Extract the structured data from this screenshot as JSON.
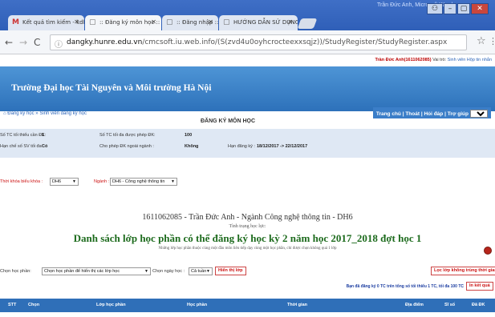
{
  "browser": {
    "tabs": [
      {
        "favicon": "M",
        "title": "Kết quả tìm kiếm - kdhc",
        "active": false
      },
      {
        "favicon": "▢",
        "title": ":: Đăng ký môn học ::",
        "active": true
      },
      {
        "favicon": "▢",
        "title": ":: Đăng nhập ::",
        "active": false
      },
      {
        "favicon": "▢",
        "title": "HƯỚNG DẪN SỬ DỤNG",
        "active": false
      }
    ],
    "url_prefix": "ⓘ ",
    "url_domain": "dangky.hunre.edu.vn",
    "url_path": "/cmcsoft.iu.web.info/(S(zvd4u0oyhcrocteexxsqjz))/StudyRegister/StudyRegister.aspx",
    "user_ghost": "Trần Đức Anh, Microsoft Word"
  },
  "page": {
    "user_name": "Trần Đức Anh(1611062085)",
    "user_role": "Vai trò:",
    "user_role_value": "Sinh viên Hộp tin nhắn",
    "header_title": "Trường Đại học Tài Nguyên và Môi trường Hà Nội",
    "breadcrumb": "⌂ Đăng ký học » Sinh viên đăng ký học",
    "page_title": "ĐĂNG KÝ MÔN HỌC",
    "top_links": "Trang chủ | Thoát | Hỏi đáp | Trợ giúp",
    "lang": "VN",
    "info": {
      "min_credits_label": "Số TC tối thiểu cần ĐK:",
      "min_credits_value": "1",
      "max_credits_label": "Số TC tối đa được phép ĐK:",
      "max_credits_value": "100",
      "limit_label": "Hạn chế số SV tối đa :",
      "limit_value": "Có",
      "other_major_label": "Cho phép ĐK ngoài ngành :",
      "other_major_value": "Không",
      "deadline_label": "Hạn đăng ký :",
      "deadline_value": "18/12/2017 -> 22/12/2017"
    },
    "filter": {
      "cohort_label": "Thời khóa biểu khóa :",
      "cohort_value": "DH6",
      "major_label": "Ngành :",
      "major_value": "DH6 - Công nghệ thông tin"
    },
    "student_line": "1611062085 - Trần Đức Anh - Ngành Công nghệ thông tin - DH6",
    "status_line": "Tình trạng học lực:",
    "list_title": "Danh sách lớp học phần có thể đăng ký học kỳ 2 năm học 2017_2018 đợt học 1",
    "note": "Những lớp học phần thuộc cùng một đầu môn liên tiếp dạy cùng một học phần, chỉ được chọn không quá 1 lớp",
    "controls": {
      "course_label": "Chọn học phần:",
      "course_value": "Chọn học phần để hiển thị các lớp học",
      "day_label": "Chọn ngày học :",
      "day_value": "Cả tuần",
      "show_button": "Hiển thị lớp",
      "conflict_button": "Lọc lớp không trùng thời gian",
      "print_button": "In kết quả"
    },
    "summary": "Bạn đã đăng ký 0 TC trên tổng số tối thiểu 1 TC, tối đa 100 TC",
    "table_headers": [
      "STT",
      "Chọn",
      "Lớp học phần",
      "Học phần",
      "Thời gian",
      "Địa điểm",
      "Sĩ số",
      "Đã ĐK"
    ]
  }
}
